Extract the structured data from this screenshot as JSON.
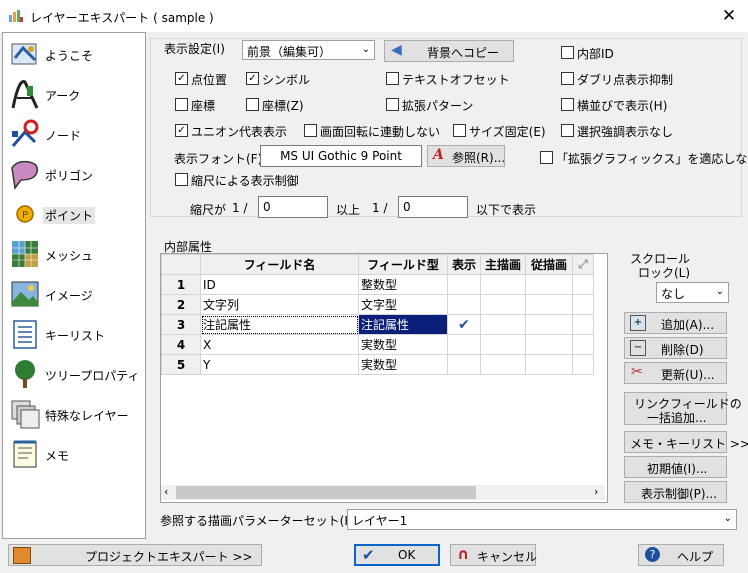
{
  "window": {
    "title": "レイヤーエキスパート ( sample )",
    "close": "✕"
  },
  "nav": {
    "items": [
      {
        "label": "ようこそ"
      },
      {
        "label": "アーク"
      },
      {
        "label": "ノード"
      },
      {
        "label": "ポリゴン"
      },
      {
        "label": "ポイント",
        "selected": true
      },
      {
        "label": "メッシュ"
      },
      {
        "label": "イメージ"
      },
      {
        "label": "キーリスト"
      },
      {
        "label": "ツリープロパティ"
      },
      {
        "label": "特殊なレイヤー"
      },
      {
        "label": "メモ"
      }
    ]
  },
  "display": {
    "setting_label": "表示設定(I)",
    "setting_value": "前景（編集可）",
    "copy_button": "背景へコピー",
    "font_label": "表示フォント(F)",
    "font_value": "MS UI Gothic 9 Point",
    "ref_button": "参照(R)...",
    "scale_prefix": "縮尺が",
    "scale_ratio1": "1 /",
    "scale_min": "0",
    "scale_mid": "以上",
    "scale_ratio2": "1 /",
    "scale_max": "0",
    "scale_suffix": "以下で表示"
  },
  "checkboxes": {
    "point_pos": {
      "label": "点位置",
      "checked": true
    },
    "symbol": {
      "label": "シンボル",
      "checked": true
    },
    "text_offset": {
      "label": "テキストオフセット",
      "checked": false
    },
    "internal_id": {
      "label": "内部ID",
      "checked": false
    },
    "coord": {
      "label": "座標",
      "checked": false
    },
    "coord_z": {
      "label": "座標(Z)",
      "checked": false
    },
    "ext_pattern": {
      "label": "拡張パターン",
      "checked": false
    },
    "dup_suppress": {
      "label": "ダブリ点表示抑制",
      "checked": false
    },
    "side_by_side": {
      "label": "横並びで表示(H)",
      "checked": false
    },
    "union_rep": {
      "label": "ユニオン代表表示",
      "checked": true
    },
    "rotate_link": {
      "label": "画面回転に連動しない",
      "checked": false
    },
    "size_fixed": {
      "label": "サイズ固定(E)",
      "checked": false
    },
    "select_emph": {
      "label": "選択強調表示なし",
      "checked": false
    },
    "ext_graphics": {
      "label": "「拡張グラフィックス」を適応しない",
      "checked": false
    },
    "scale_control": {
      "label": "縮尺による表示制御",
      "checked": false
    }
  },
  "attributes": {
    "group_label": "内部属性",
    "columns": [
      "フィールド名",
      "フィールド型",
      "表示",
      "主描画",
      "従描画"
    ],
    "rows": [
      {
        "num": "1",
        "name": "ID",
        "type": "整数型",
        "show": ""
      },
      {
        "num": "2",
        "name": "文字列",
        "type": "文字型",
        "show": ""
      },
      {
        "num": "3",
        "name": "注記属性",
        "type": "注記属性",
        "show": "✔"
      },
      {
        "num": "4",
        "name": "X",
        "type": "実数型",
        "show": ""
      },
      {
        "num": "5",
        "name": "Y",
        "type": "実数型",
        "show": ""
      }
    ]
  },
  "side": {
    "scroll_lock_label1": "スクロール",
    "scroll_lock_label2": "ロック(L)",
    "scroll_lock_value": "なし",
    "add": "追加(A)...",
    "delete": "削除(D)",
    "update": "更新(U)...",
    "link_field1": "リンクフィールドの",
    "link_field2": "一括追加...",
    "memo_keylist": "メモ・キーリスト >>",
    "initial_value": "初期値(I)...",
    "display_control": "表示制御(P)..."
  },
  "param_set": {
    "label": "参照する描画パラメーターセット(P)",
    "value": "レイヤー1"
  },
  "footer": {
    "project_expert": "プロジェクトエキスパート >>",
    "ok": "OK",
    "cancel": "キャンセル",
    "help": "ヘルプ"
  }
}
